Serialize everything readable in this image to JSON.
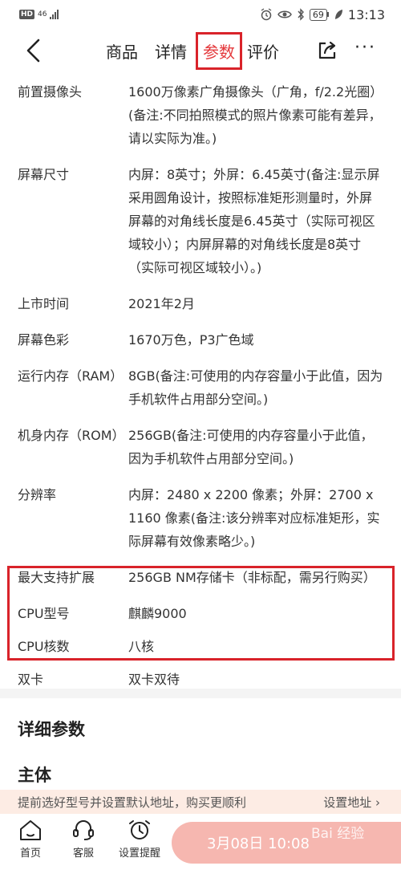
{
  "status_bar": {
    "hd": "HD",
    "network": "46",
    "battery": "69",
    "time": "13:13"
  },
  "nav": {
    "tabs": [
      {
        "label": "商品",
        "active": false
      },
      {
        "label": "详情",
        "active": false
      },
      {
        "label": "参数",
        "active": true
      },
      {
        "label": "评价",
        "active": false
      }
    ],
    "more_label": "···"
  },
  "params": [
    {
      "key": "前置摄像头",
      "value": "1600万像素广角摄像头（广角，f/2.2光圈）(备注:不同拍照模式的照片像素可能有差异，请以实际为准。)"
    },
    {
      "key": "屏幕尺寸",
      "value": "内屏：8英寸；外屏：6.45英寸(备注:显示屏采用圆角设计，按照标准矩形测量时，外屏屏幕的对角线长度是6.45英寸（实际可视区域较小）；内屏屏幕的对角线长度是8英寸（实际可视区域较小）。)"
    },
    {
      "key": "上市时间",
      "value": "2021年2月"
    },
    {
      "key": "屏幕色彩",
      "value": "1670万色，P3广色域"
    },
    {
      "key": "运行内存（RAM）",
      "value": "8GB(备注:可使用的内存容量小于此值，因为手机软件占用部分空间。)"
    },
    {
      "key": "机身内存（ROM）",
      "value": "256GB(备注:可使用的内存容量小于此值，因为手机软件占用部分空间。)"
    },
    {
      "key": "分辨率",
      "value": "内屏：2480 x 2200 像素；外屏：2700 x 1160 像素(备注:该分辨率对应标准矩形，实际屏幕有效像素略少。)"
    },
    {
      "key": "最大支持扩展",
      "value": "256GB NM存储卡（非标配，需另行购买）"
    },
    {
      "key": "CPU型号",
      "value": "麒麟9000"
    },
    {
      "key": "CPU核数",
      "value": "八核"
    },
    {
      "key": "双卡",
      "value": "双卡双待"
    }
  ],
  "sections": {
    "detail_title": "详细参数",
    "main_title": "主体"
  },
  "address_hint": {
    "text": "提前选好型号并设置默认地址，购买更顺利",
    "link": "设置地址 ›"
  },
  "bottom_bar": {
    "home": "首页",
    "service": "客服",
    "reminder": "设置提醒",
    "buy_label": "3月08日 10:08"
  },
  "watermark": "Bai 经验",
  "colors": {
    "accent": "#e4393c",
    "highlight_border": "#d9232a",
    "buy_button": "#f6b7b0",
    "address_bg": "#fdece4"
  }
}
